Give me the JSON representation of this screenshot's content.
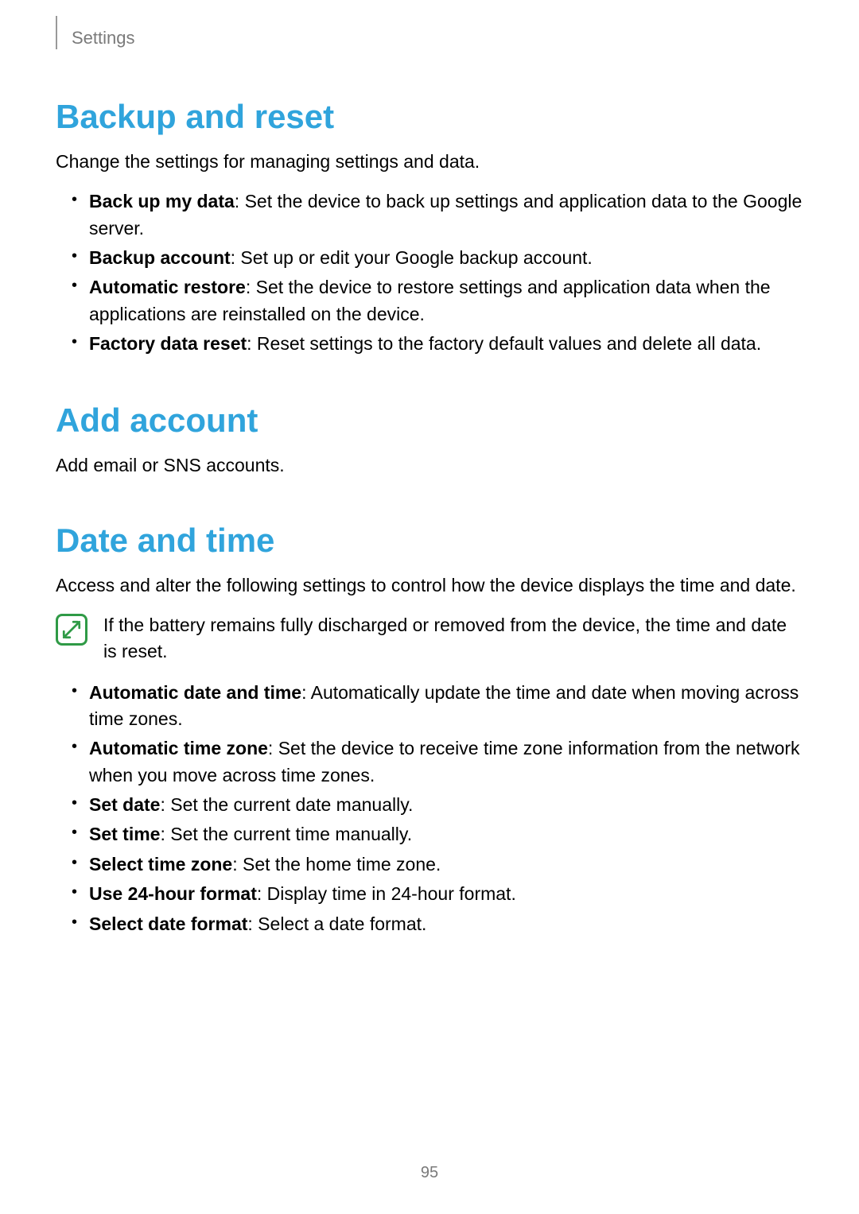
{
  "header": {
    "breadcrumb": "Settings"
  },
  "sections": {
    "backup": {
      "heading": "Backup and reset",
      "intro": "Change the settings for managing settings and data.",
      "items": [
        {
          "label": "Back up my data",
          "desc": ": Set the device to back up settings and application data to the Google server."
        },
        {
          "label": "Backup account",
          "desc": ": Set up or edit your Google backup account."
        },
        {
          "label": "Automatic restore",
          "desc": ": Set the device to restore settings and application data when the applications are reinstalled on the device."
        },
        {
          "label": "Factory data reset",
          "desc": ": Reset settings to the factory default values and delete all data."
        }
      ]
    },
    "add_account": {
      "heading": "Add account",
      "intro": "Add email or SNS accounts."
    },
    "date_time": {
      "heading": "Date and time",
      "intro": "Access and alter the following settings to control how the device displays the time and date.",
      "note": "If the battery remains fully discharged or removed from the device, the time and date is reset.",
      "items": [
        {
          "label": "Automatic date and time",
          "desc": ": Automatically update the time and date when moving across time zones."
        },
        {
          "label": "Automatic time zone",
          "desc": ": Set the device to receive time zone information from the network when you move across time zones."
        },
        {
          "label": "Set date",
          "desc": ": Set the current date manually."
        },
        {
          "label": "Set time",
          "desc": ": Set the current time manually."
        },
        {
          "label": "Select time zone",
          "desc": ": Set the home time zone."
        },
        {
          "label": "Use 24-hour format",
          "desc": ": Display time in 24-hour format."
        },
        {
          "label": "Select date format",
          "desc": ": Select a date format."
        }
      ]
    }
  },
  "page_number": "95"
}
